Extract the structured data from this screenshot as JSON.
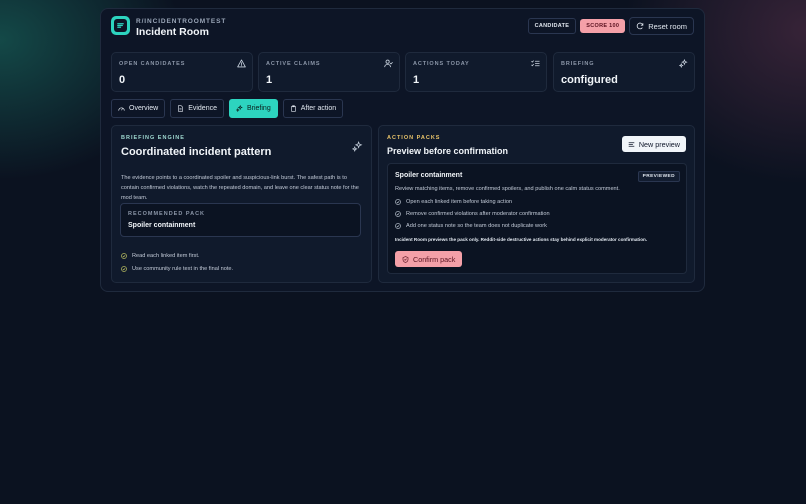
{
  "header": {
    "subtitle": "R/INCIDENTROOMTEST",
    "title": "Incident Room",
    "badge_candidate": "CANDIDATE",
    "badge_score": "SCORE 100",
    "reset_label": "Reset room"
  },
  "stats": [
    {
      "label": "OPEN CANDIDATES",
      "value": "0",
      "icon": "alert-triangle-icon"
    },
    {
      "label": "ACTIVE CLAIMS",
      "value": "1",
      "icon": "user-check-icon"
    },
    {
      "label": "ACTIONS TODAY",
      "value": "1",
      "icon": "list-check-icon"
    },
    {
      "label": "BRIEFING",
      "value": "configured",
      "icon": "sparkles-icon"
    }
  ],
  "tabs": [
    {
      "label": "Overview",
      "icon": "gauge-icon",
      "active": false
    },
    {
      "label": "Evidence",
      "icon": "file-icon",
      "active": false
    },
    {
      "label": "Briefing",
      "icon": "sparkles-icon",
      "active": true
    },
    {
      "label": "After action",
      "icon": "clipboard-icon",
      "active": false
    }
  ],
  "briefing": {
    "eyebrow": "BRIEFING ENGINE",
    "title": "Coordinated incident pattern",
    "body": "The evidence points to a coordinated spoiler and suspicious-link burst. The safest path is to contain confirmed violations, watch the repeated domain, and leave one clear status note for the mod team.",
    "recommended_label": "RECOMMENDED PACK",
    "recommended_value": "Spoiler containment",
    "checks": [
      "Read each linked item first.",
      "Use community rule text in the final note."
    ]
  },
  "actions": {
    "eyebrow": "ACTION PACKS",
    "title": "Preview before confirmation",
    "new_preview_label": "New preview",
    "pack": {
      "name": "Spoiler containment",
      "status": "PREVIEWED",
      "description": "Review matching items, remove confirmed spoilers, and publish one calm status comment.",
      "steps": [
        "Open each linked item before taking action",
        "Remove confirmed violations after moderator confirmation",
        "Add one status note so the team does not duplicate work"
      ],
      "footnote": "Incident Room previews the pack only. Reddit-side destructive actions stay behind explicit moderator confirmation.",
      "confirm_label": "Confirm pack"
    }
  },
  "colors": {
    "accent": "#2dd4bf",
    "danger": "#f4a0a8",
    "eyebrow_briefing": "#9ed7cf",
    "eyebrow_actions": "#e9c46a"
  }
}
